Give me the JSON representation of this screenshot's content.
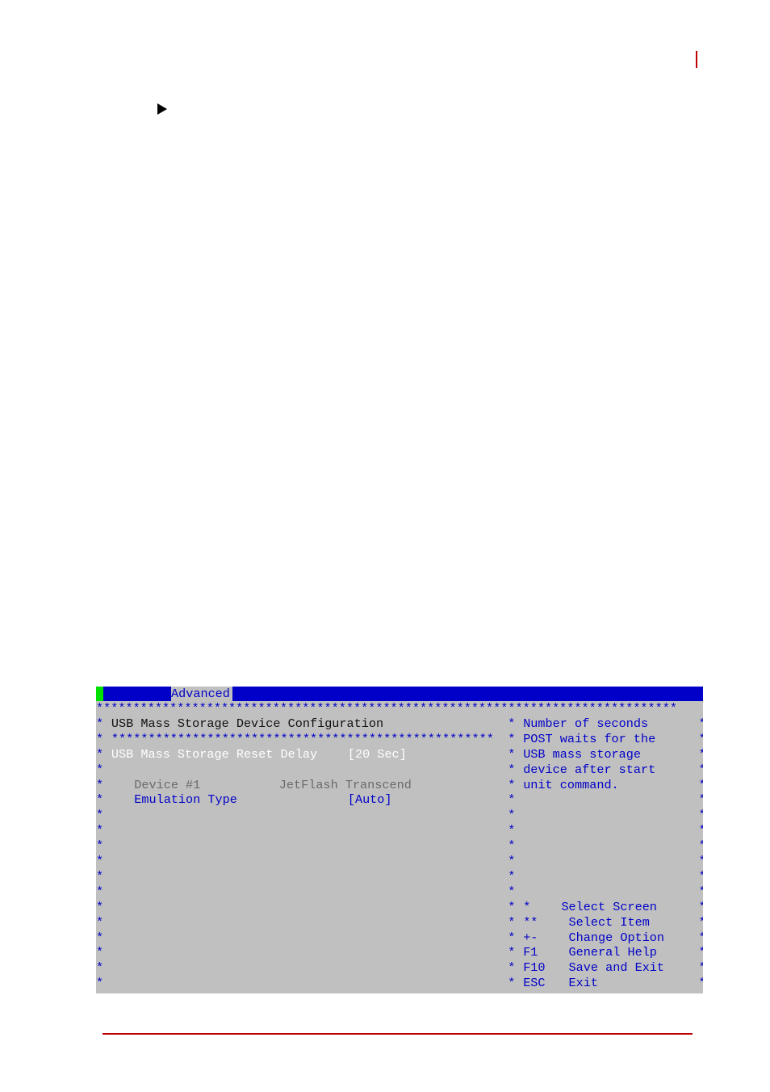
{
  "page": {
    "accent_color": "#c00000"
  },
  "bios": {
    "colors": {
      "background": "#c0c0c0",
      "bar": "#0000c8",
      "indicator": "#00e000",
      "text": "#0000c8",
      "highlight": "#ffffff"
    },
    "active_tab": "Advanced",
    "border_row": "*******************************************************************************",
    "left_panel": {
      "title": "USB Mass Storage Device Configuration",
      "separator": "****************************************************",
      "selected_item": {
        "label": "USB Mass Storage Reset Delay",
        "value": "[20 Sec]"
      },
      "device": {
        "label": "Device #1",
        "value": "JetFlash Transcend"
      },
      "emulation": {
        "label": "Emulation Type",
        "value": "[Auto]"
      }
    },
    "help_panel": {
      "description": [
        "Number of seconds",
        "POST waits for the",
        "USB mass storage",
        "device after start",
        "unit command."
      ],
      "keys": [
        {
          "key": "*",
          "action": "Select Screen"
        },
        {
          "key": "**",
          "action": " Select Item"
        },
        {
          "key": "+-",
          "action": " Change Option"
        },
        {
          "key": "F1",
          "action": " General Help"
        },
        {
          "key": "F10",
          "action": " Save and Exit"
        },
        {
          "key": "ESC",
          "action": " Exit"
        }
      ]
    },
    "star": "*"
  }
}
